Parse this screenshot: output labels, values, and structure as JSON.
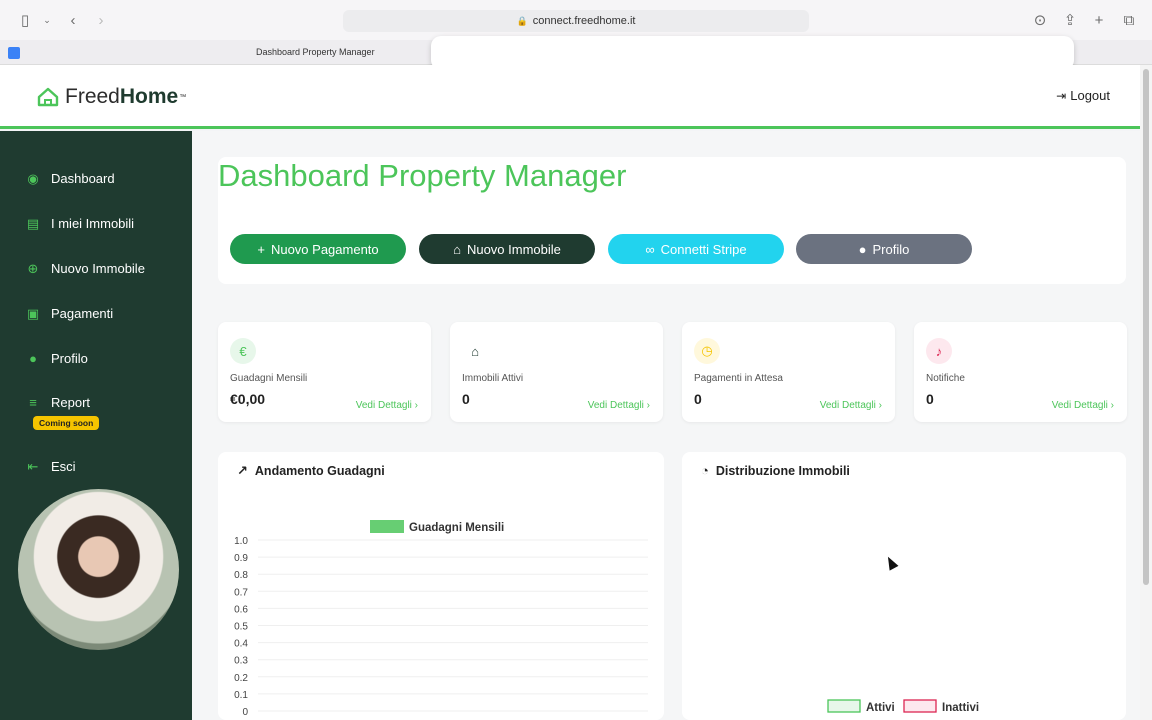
{
  "browser": {
    "url": "connect.freedhome.it",
    "tab_title": "Dashboard Property Manager"
  },
  "header": {
    "logo_light": "Freed",
    "logo_bold": "Home",
    "logo_tm": "™",
    "logout_label": "Logout"
  },
  "sidebar": {
    "items": [
      {
        "label": "Dashboard",
        "icon": "palette-icon"
      },
      {
        "label": "I miei Immobili",
        "icon": "building-icon"
      },
      {
        "label": "Nuovo Immobile",
        "icon": "plus-circle-icon"
      },
      {
        "label": "Pagamenti",
        "icon": "money-icon"
      },
      {
        "label": "Profilo",
        "icon": "user-icon"
      },
      {
        "label": "Report",
        "icon": "chart-icon"
      },
      {
        "label": "Esci",
        "icon": "exit-icon"
      }
    ],
    "report_badge": "Coming soon"
  },
  "main": {
    "title": "Dashboard Property Manager",
    "actions": [
      {
        "label": "Nuovo Pagamento",
        "color": "#1f9a4f",
        "icon": "plus-icon"
      },
      {
        "label": "Nuovo Immobile",
        "color": "#1f3b30",
        "icon": "home-icon"
      },
      {
        "label": "Connetti Stripe",
        "color": "#22d3ee",
        "icon": "link-icon"
      },
      {
        "label": "Profilo",
        "color": "#6b7280",
        "icon": "user-icon"
      }
    ],
    "stats": [
      {
        "label": "Guadagni Mensili",
        "value": "€0,00",
        "link": "Vedi Dettagli",
        "icon": "euro-icon",
        "icon_color": "#4cc55a",
        "icon_bg": "#e7f7ea"
      },
      {
        "label": "Immobili Attivi",
        "value": "0",
        "link": "Vedi Dettagli",
        "icon": "home-icon",
        "icon_color": "#1f3b30",
        "icon_bg": "#ffffff"
      },
      {
        "label": "Pagamenti in Attesa",
        "value": "0",
        "link": "Vedi Dettagli",
        "icon": "clock-icon",
        "icon_color": "#f5c400",
        "icon_bg": "#fff8dc"
      },
      {
        "label": "Notifiche",
        "value": "0",
        "link": "Vedi Dettagli",
        "icon": "bell-icon",
        "icon_color": "#dc2653",
        "icon_bg": "#fde8ee"
      }
    ],
    "earnings_chart_title": "Andamento Guadagni",
    "distribution_chart_title": "Distribuzione Immobili"
  },
  "chart_data": [
    {
      "type": "bar",
      "title": "",
      "series": [
        {
          "name": "Guadagni Mensili",
          "values": []
        }
      ],
      "categories": [],
      "y_ticks": [
        "0",
        "0.1",
        "0.2",
        "0.3",
        "0.4",
        "0.5",
        "0.6",
        "0.7",
        "0.8",
        "0.9",
        "1.0"
      ],
      "ylim": [
        0,
        1
      ],
      "grid": true,
      "legend": "top-center",
      "color": "#4cc55a"
    },
    {
      "type": "pie",
      "title": "",
      "legend": [
        "Attivi",
        "Inattivi"
      ],
      "legend_colors": [
        "#4cc55a",
        "#dc2653"
      ],
      "values": [],
      "legend_position": "bottom-center"
    }
  ]
}
